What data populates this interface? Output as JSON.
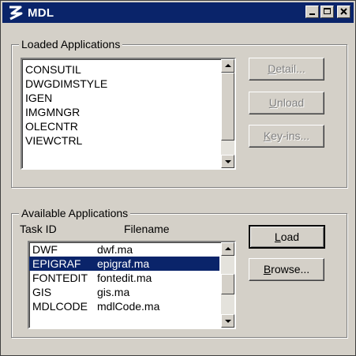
{
  "window": {
    "title": "MDL"
  },
  "loaded": {
    "label": "Loaded Applications",
    "items": [
      "CONSUTIL",
      "DWGDIMSTYLE",
      "IGEN",
      "IMGMNGR",
      "OLECNTR",
      "VIEWCTRL"
    ],
    "buttons": {
      "detail": {
        "mnemonic": "D",
        "rest": "etail..."
      },
      "unload": {
        "mnemonic": "U",
        "rest": "nload"
      },
      "keyins": {
        "mnemonic": "K",
        "rest": "ey-ins..."
      }
    }
  },
  "available": {
    "label": "Available Applications",
    "col_task": "Task ID",
    "col_file": "Filename",
    "rows": [
      {
        "task": "DWF",
        "file": "dwf.ma"
      },
      {
        "task": "EPIGRAF",
        "file": "epigraf.ma"
      },
      {
        "task": "FONTEDIT",
        "file": "fontedit.ma"
      },
      {
        "task": "GIS",
        "file": "gis.ma"
      },
      {
        "task": "MDLCODE",
        "file": "mdlCode.ma"
      }
    ],
    "selected_index": 1,
    "buttons": {
      "load": {
        "mnemonic": "L",
        "rest": "oad"
      },
      "browse": {
        "mnemonic": "B",
        "rest": "rowse..."
      }
    }
  }
}
